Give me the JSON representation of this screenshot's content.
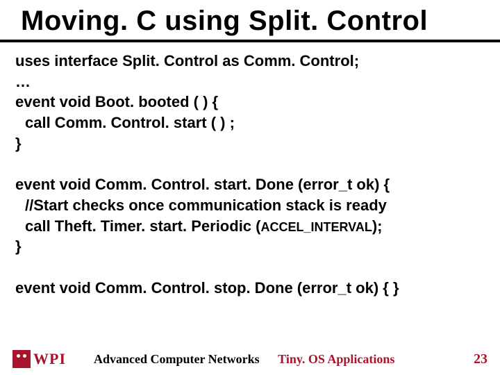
{
  "title": "Moving. C using Split. Control",
  "code": {
    "l1": "uses interface Split. Control as Comm. Control;",
    "l2": "…",
    "l3": "event void Boot. booted ( ) {",
    "l4": "call Comm. Control. start ( ) ;",
    "l5": "}",
    "l6": "event void Comm. Control. start. Done (error_t ok) {",
    "l7": "//Start checks once communication stack is ready",
    "l8a": "call Theft. Timer. start. Periodic (",
    "l8b": "ACCEL_INTERVAL",
    "l8c": ");",
    "l9": "}",
    "l10": "event void Comm. Control. stop. Done (error_t ok) { }"
  },
  "footer": {
    "logo_text": "WPI",
    "course": "Advanced Computer Networks",
    "topic": "Tiny. OS Applications",
    "page": "23"
  }
}
